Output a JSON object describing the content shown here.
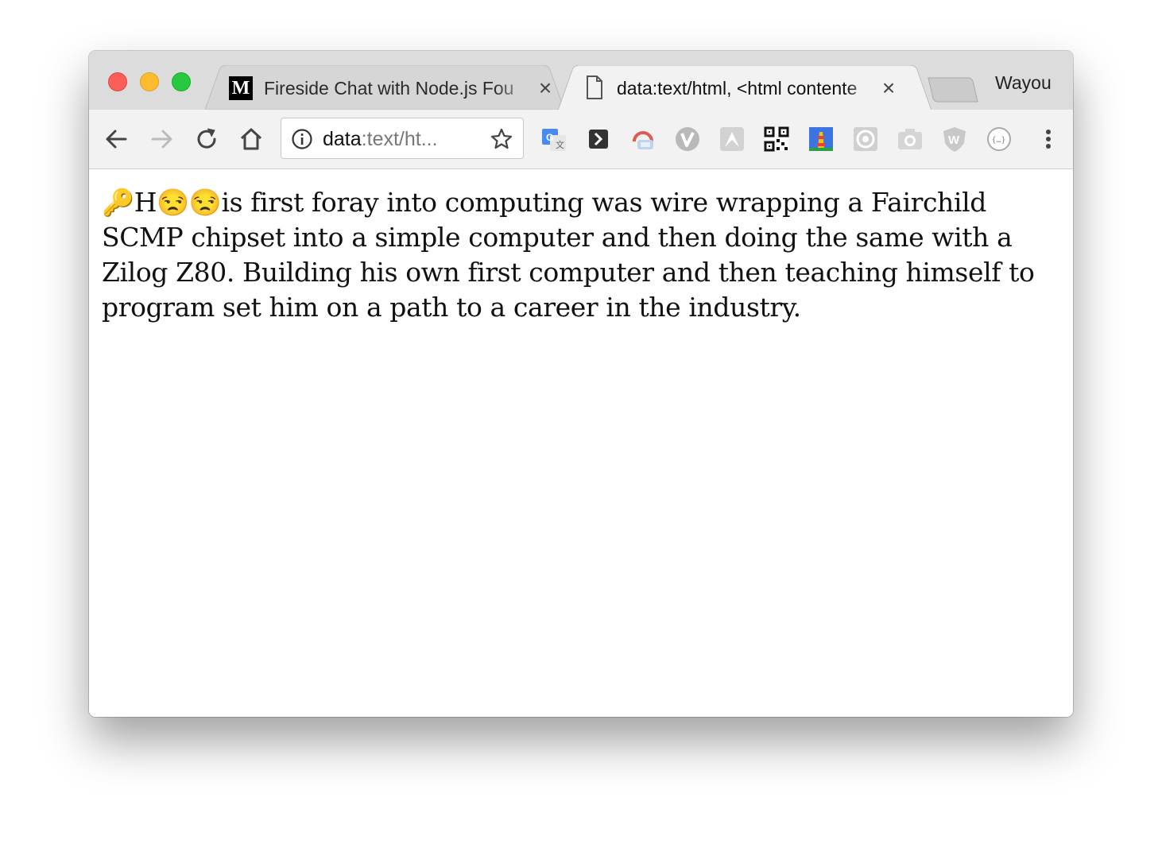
{
  "window": {
    "tabs": [
      {
        "title": "Fireside Chat with Node.js Fou",
        "favicon": "medium-logo-icon",
        "active": false
      },
      {
        "title": "data:text/html, <html contente",
        "favicon": "document-icon",
        "active": true
      }
    ],
    "profile_name": "Wayou"
  },
  "toolbar": {
    "omnibox": {
      "scheme": "data",
      "rest": ":text/ht..."
    },
    "extensions": [
      "google-translate-icon",
      "pushbullet-icon",
      "cloud-sync-icon",
      "vimium-icon",
      "arrow-up-extension-icon",
      "qr-code-icon",
      "lighthouse-icon",
      "chrome-ext-grey-icon",
      "camera-icon",
      "w-shield-icon",
      "json-viewer-icon"
    ]
  },
  "content": {
    "paragraph": "🔑H😒😒is first foray into computing was wire wrapping a Fairchild SCMP chipset into a simple computer and then doing the same with a Zilog Z80. Building his own first computer and then teaching himself to program set him on a path to a career in the industry."
  }
}
